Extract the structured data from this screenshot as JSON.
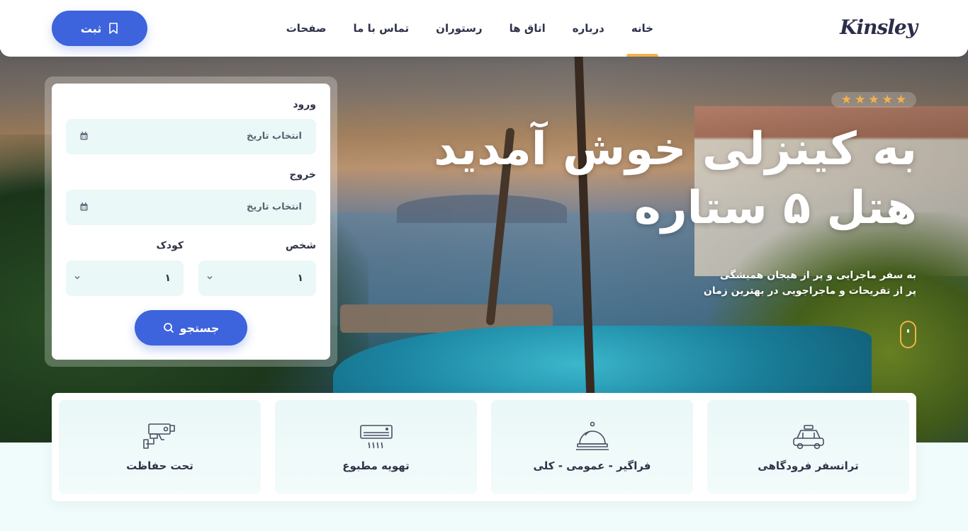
{
  "header": {
    "logo": "Kinsley",
    "nav": [
      {
        "label": "خانه",
        "active": true
      },
      {
        "label": "درباره",
        "active": false
      },
      {
        "label": "اتاق ها",
        "active": false
      },
      {
        "label": "رستوران",
        "active": false
      },
      {
        "label": "تماس با ما",
        "active": false
      },
      {
        "label": "صفحات",
        "active": false
      }
    ],
    "register_label": "ثبت",
    "register_icon": "bookmark-icon"
  },
  "hero": {
    "rating_stars": 5,
    "title_line1": "به کینزلی خوش آمدید",
    "title_line2": "هتل ۵ ستاره",
    "subtitle_line1": "به سفر ماجرایی و پر از هیجان همیشگی",
    "subtitle_line2": "پر از تفریحات و ماجراجویی در بهترین زمان"
  },
  "booking": {
    "checkin_label": "ورود",
    "checkin_placeholder": "انتخاب تاریخ",
    "checkout_label": "خروج",
    "checkout_placeholder": "انتخاب تاریخ",
    "adult_label": "شخص",
    "adult_value": "۱",
    "child_label": "کودک",
    "child_value": "۱",
    "search_label": "جستجو"
  },
  "features": [
    {
      "label": "ترانسفر فرودگاهی",
      "icon": "taxi-icon"
    },
    {
      "label": "فراگیر - عمومی - کلی",
      "icon": "service-bell-icon"
    },
    {
      "label": "تهویه مطبوع",
      "icon": "air-conditioner-icon"
    },
    {
      "label": "تحت حفاظت",
      "icon": "security-camera-icon"
    }
  ],
  "colors": {
    "accent": "#3d63dd",
    "highlight": "#f2b24b",
    "field_bg": "#eaf8f7",
    "text_dark": "#2f3349"
  }
}
